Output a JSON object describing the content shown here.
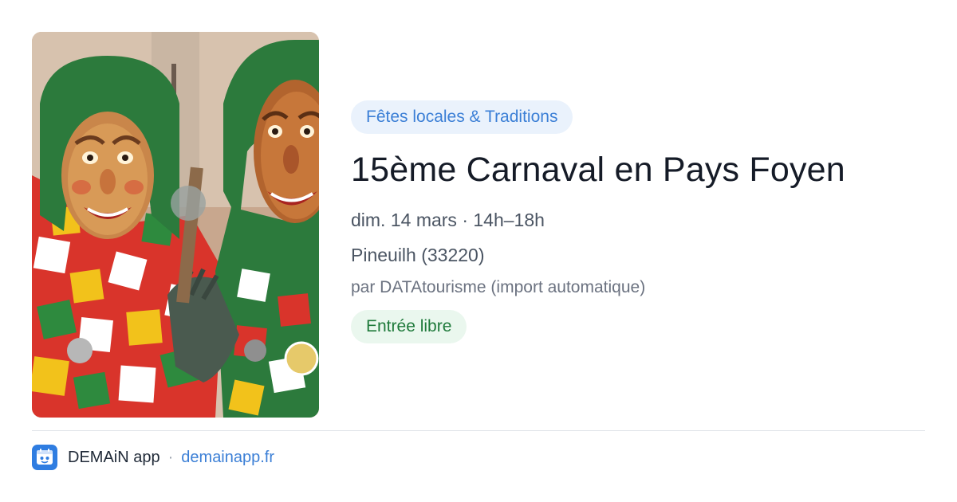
{
  "event": {
    "category": "Fêtes locales & Traditions",
    "title": "15ème Carnaval en Pays Foyen",
    "datetime": "dim. 14 mars · 14h–18h",
    "location": "Pineuilh (33220)",
    "organizer": "par DATAtourisme (import automatique)",
    "price": "Entrée libre"
  },
  "footer": {
    "app_name": "DEMAiN app",
    "separator": "·",
    "site": "demainapp.fr"
  },
  "colors": {
    "accent": "#3b7fd6",
    "category_bg": "#eaf2fc",
    "price_text": "#1f7a3b",
    "price_bg": "#eaf7ee",
    "title": "#151b27",
    "logo_bg": "#2f7de1"
  },
  "icons": {
    "app_logo": "demain-app-logo-icon"
  }
}
